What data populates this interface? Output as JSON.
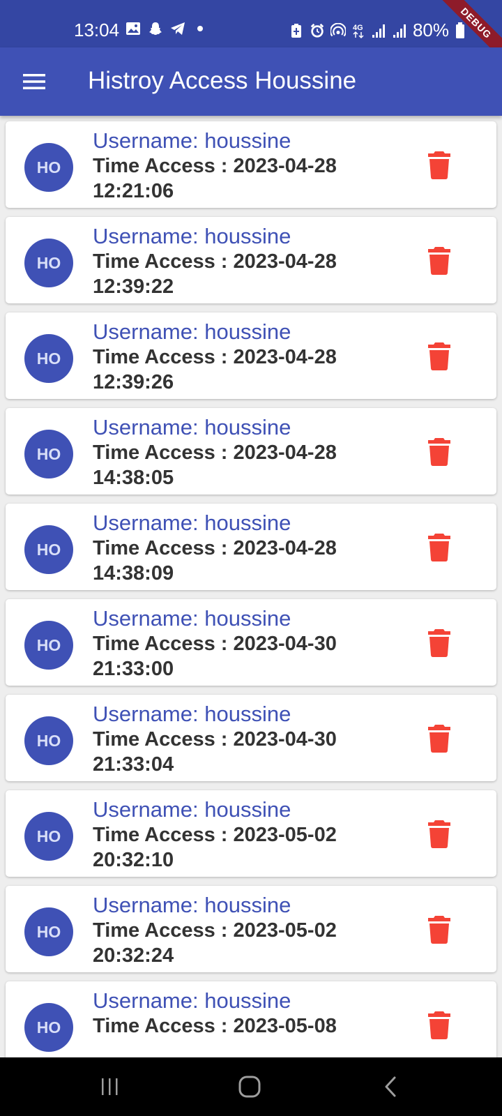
{
  "status_bar": {
    "time": "13:04",
    "battery": "80%",
    "network": "4G",
    "debug_label": "DEBUG",
    "left_icons": [
      "image-icon",
      "snapchat-icon",
      "telegram-icon",
      "dot-icon"
    ],
    "right_icons": [
      "battery-saver-icon",
      "alarm-icon",
      "hotspot-icon",
      "network-4g-icon",
      "signal-icon",
      "signal-icon",
      "battery-icon"
    ]
  },
  "app_bar": {
    "title": "Histroy Access Houssine",
    "menu_icon": "menu-icon"
  },
  "colors": {
    "status_bar": "#3446a3",
    "app_bar": "#3f51b5",
    "accent": "#3f51b5",
    "delete": "#f44336",
    "background": "#eeeeee"
  },
  "history": [
    {
      "avatar": "HO",
      "username": "Username: houssine",
      "time_access": "Time Access : 2023-04-28 12:21:06"
    },
    {
      "avatar": "HO",
      "username": "Username: houssine",
      "time_access": "Time Access : 2023-04-28 12:39:22"
    },
    {
      "avatar": "HO",
      "username": "Username: houssine",
      "time_access": "Time Access : 2023-04-28 12:39:26"
    },
    {
      "avatar": "HO",
      "username": "Username: houssine",
      "time_access": "Time Access : 2023-04-28 14:38:05"
    },
    {
      "avatar": "HO",
      "username": "Username: houssine",
      "time_access": "Time Access : 2023-04-28 14:38:09"
    },
    {
      "avatar": "HO",
      "username": "Username: houssine",
      "time_access": "Time Access : 2023-04-30 21:33:00"
    },
    {
      "avatar": "HO",
      "username": "Username: houssine",
      "time_access": "Time Access : 2023-04-30 21:33:04"
    },
    {
      "avatar": "HO",
      "username": "Username: houssine",
      "time_access": "Time Access : 2023-05-02 20:32:10"
    },
    {
      "avatar": "HO",
      "username": "Username: houssine",
      "time_access": "Time Access : 2023-05-02 20:32:24"
    },
    {
      "avatar": "HO",
      "username": "Username: houssine",
      "time_access": "Time Access : 2023-05-08"
    }
  ],
  "nav_bar": {
    "icons": [
      "recent-apps-icon",
      "home-icon",
      "back-icon"
    ]
  }
}
